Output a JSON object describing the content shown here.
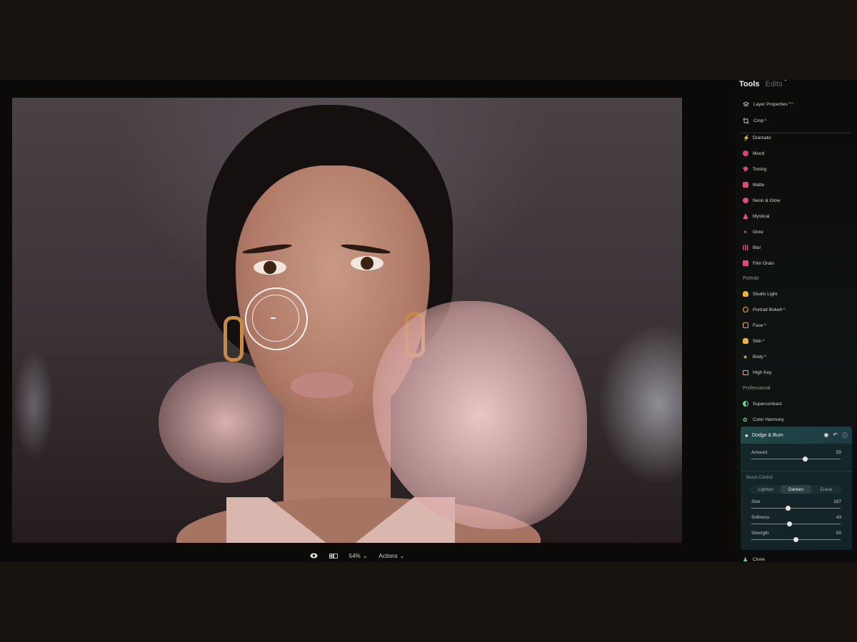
{
  "sidebar": {
    "tabs": {
      "tools": "Tools",
      "edits": "Edits"
    },
    "top_items": [
      {
        "label": "Layer Properties",
        "badge": "PRO",
        "icon": "layers-icon"
      },
      {
        "label": "Crop",
        "badge": "AI",
        "icon": "crop-icon"
      }
    ],
    "creative_items": [
      {
        "label": "Dramatic",
        "icon": "bolt-icon",
        "color": "#e05a9a"
      },
      {
        "label": "Mood",
        "icon": "mood-icon",
        "color": "#e0407a"
      },
      {
        "label": "Toning",
        "icon": "toning-icon",
        "color": "#e0407a"
      },
      {
        "label": "Matte",
        "icon": "matte-icon",
        "color": "#e04a7a"
      },
      {
        "label": "Neon & Glow",
        "icon": "neon-icon",
        "color": "#e04a8a"
      },
      {
        "label": "Mystical",
        "icon": "mystical-icon",
        "color": "#e04a8a"
      },
      {
        "label": "Glow",
        "icon": "glow-icon",
        "color": "#e04a8a"
      },
      {
        "label": "Blur",
        "icon": "blur-icon",
        "color": "#e04a7a"
      },
      {
        "label": "Film Grain",
        "icon": "film-grain-icon",
        "color": "#e04a7a"
      }
    ],
    "portrait_section": "Portrait",
    "portrait_items": [
      {
        "label": "Studio Light",
        "badge": "",
        "icon": "studio-light-icon"
      },
      {
        "label": "Portrait Bokeh",
        "badge": "AI",
        "icon": "bokeh-icon"
      },
      {
        "label": "Face",
        "badge": "AI",
        "icon": "face-icon"
      },
      {
        "label": "Skin",
        "badge": "AI",
        "icon": "skin-icon"
      },
      {
        "label": "Body",
        "badge": "AI",
        "icon": "body-icon"
      },
      {
        "label": "High Key",
        "badge": "",
        "icon": "high-key-icon"
      }
    ],
    "professional_section": "Professional",
    "professional_items": [
      {
        "label": "Supercontrast",
        "icon": "supercontrast-icon"
      },
      {
        "label": "Color Harmony",
        "icon": "color-harmony-icon"
      }
    ],
    "below_item": {
      "label": "Clone",
      "icon": "clone-icon"
    }
  },
  "panel": {
    "title": "Dodge & Burn",
    "amount": {
      "label": "Amount",
      "value": 59
    },
    "brush_control_label": "Brush Control",
    "modes": [
      "Lighten",
      "Darken",
      "Erase"
    ],
    "active_mode": "Darken",
    "size": {
      "label": "Size",
      "value": 167,
      "fraction": 0.41
    },
    "softness": {
      "label": "Softness",
      "value": 43,
      "fraction": 0.43
    },
    "strength": {
      "label": "Strength",
      "value": 50,
      "fraction": 0.5
    }
  },
  "bottom_bar": {
    "zoom": "54%",
    "actions": "Actions",
    "compare_icon": "compare-icon",
    "eye_icon": "eye-icon"
  },
  "colors": {
    "accent_portrait": "#f0b040",
    "accent_pro": "#5fe08a",
    "panel_header": "#1f4744"
  }
}
